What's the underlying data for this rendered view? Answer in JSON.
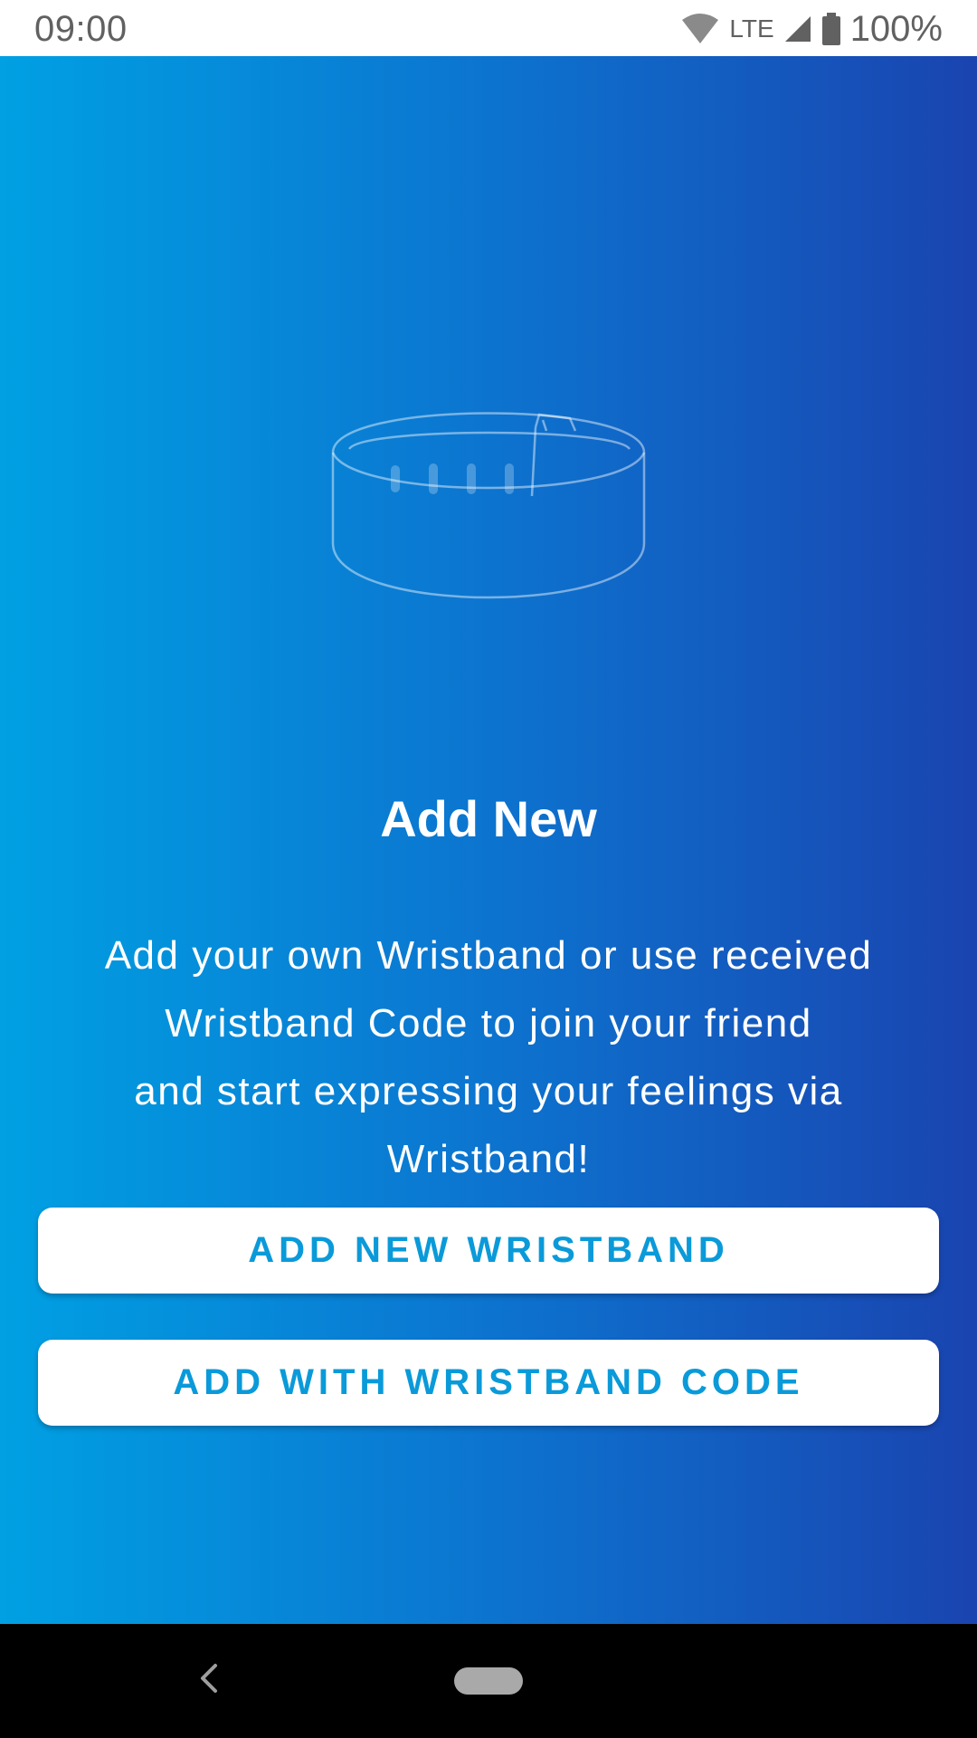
{
  "status_bar": {
    "time": "09:00",
    "network": "LTE",
    "battery": "100%",
    "icons": [
      "wifi-icon",
      "cell-signal-icon",
      "battery-icon"
    ]
  },
  "main": {
    "illustration": "wristband-illustration",
    "title": "Add New",
    "description_lines": [
      "Add your own Wristband or use received",
      "Wristband Code to join your friend",
      "and start expressing your feelings via",
      "Wristband!"
    ],
    "buttons": {
      "add_new": "ADD NEW WRISTBAND",
      "add_code": "ADD WITH WRISTBAND CODE"
    }
  },
  "nav_bar": {
    "icons": [
      "back-icon",
      "home-pill-icon"
    ]
  },
  "colors": {
    "gradient_start": "#00a0e3",
    "gradient_end": "#1a44b0",
    "button_text": "#0a9ad9"
  }
}
